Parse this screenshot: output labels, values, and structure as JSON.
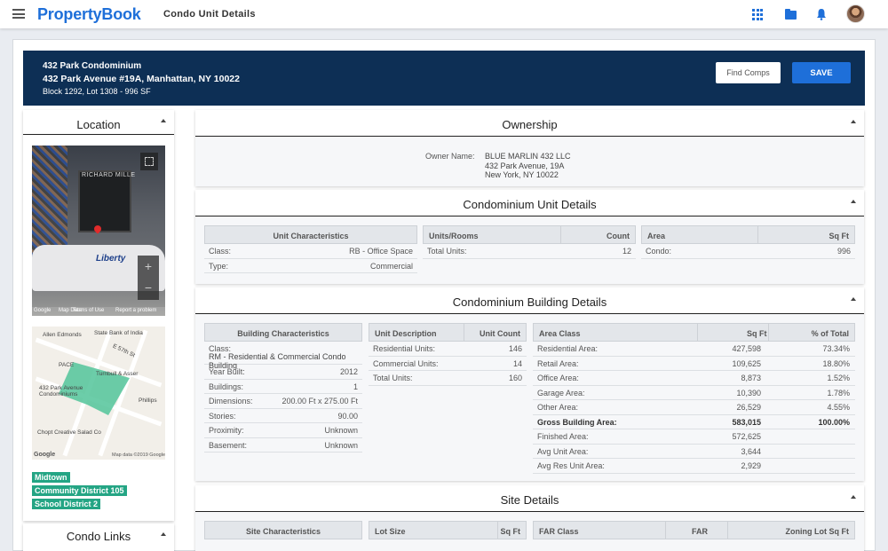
{
  "app": {
    "brand": "PropertyBook",
    "page_title": "Condo Unit Details"
  },
  "banner": {
    "line1": "432 Park Condominium",
    "line2": "432 Park Avenue #19A, Manhattan, NY 10022",
    "line3": "Block 1292, Lot 1308 - 996 SF",
    "find_comps_label": "Find Comps",
    "save_label": "SAVE"
  },
  "sidebar": {
    "location_title": "Location",
    "condo_links_title": "Condo Links",
    "streetview": {
      "store_sign": "RICHARD MILLE",
      "van_text": "Liberty",
      "terms": "Terms of Use",
      "report": "Report a problem",
      "map_data": "Map Data",
      "google": "Google"
    },
    "map": {
      "labels": [
        "Allen Edmonds",
        "State Bank of India",
        "E 57th St",
        "PACE",
        "Turnbull & Asser",
        "432 Park Avenue Condominiums",
        "Phillips",
        "Chopt Creative Salad Co"
      ],
      "footer": "Map data ©2019 Google",
      "google": "Google"
    },
    "tags": [
      "Midtown",
      "Community District 105",
      "School District 2"
    ]
  },
  "ownership": {
    "title": "Ownership",
    "owner_label": "Owner Name:",
    "owner_lines": [
      "BLUE MARLIN 432 LLC",
      "432 Park Avenue, 19A",
      "New York, NY 10022"
    ]
  },
  "unit_details": {
    "title": "Condominium Unit Details",
    "characteristics": {
      "header": "Unit Characteristics",
      "rows": [
        [
          "Class:",
          "RB - Office Space"
        ],
        [
          "Type:",
          "Commercial"
        ]
      ]
    },
    "units_rooms": {
      "header": "Units/Rooms",
      "count_header": "Count",
      "rows": [
        [
          "Total Units:",
          "12"
        ]
      ]
    },
    "area": {
      "header": "Area",
      "sqft_header": "Sq Ft",
      "rows": [
        [
          "Condo:",
          "996"
        ]
      ]
    }
  },
  "building_details": {
    "title": "Condominium Building Details",
    "characteristics": {
      "header": "Building Characteristics",
      "class_label": "Class:",
      "class_value": "RM - Residential & Commercial Condo Building",
      "rows": [
        [
          "Year Built:",
          "2012"
        ],
        [
          "Buildings:",
          "1"
        ],
        [
          "Dimensions:",
          "200.00 Ft x 275.00 Ft"
        ],
        [
          "Stories:",
          "90.00"
        ],
        [
          "Proximity:",
          "Unknown"
        ],
        [
          "Basement:",
          "Unknown"
        ]
      ]
    },
    "unit_description": {
      "header": "Unit Description",
      "count_header": "Unit Count",
      "rows": [
        [
          "Residential Units:",
          "146"
        ],
        [
          "Commercial Units:",
          "14"
        ],
        [
          "Total Units:",
          "160"
        ]
      ]
    },
    "area_class": {
      "header": "Area Class",
      "sqft_header": "Sq Ft",
      "pct_header": "% of Total",
      "rows": [
        [
          "Residential Area:",
          "427,598",
          "73.34%"
        ],
        [
          "Retail Area:",
          "109,625",
          "18.80%"
        ],
        [
          "Office Area:",
          "8,873",
          "1.52%"
        ],
        [
          "Garage Area:",
          "10,390",
          "1.78%"
        ],
        [
          "Other Area:",
          "26,529",
          "4.55%"
        ],
        [
          "Gross Building Area:",
          "583,015",
          "100.00%"
        ],
        [
          "Finished Area:",
          "572,625",
          ""
        ],
        [
          "Avg Unit Area:",
          "3,644",
          ""
        ],
        [
          "Avg Res Unit Area:",
          "2,929",
          ""
        ]
      ]
    }
  },
  "site_details": {
    "title": "Site Details",
    "characteristics_header": "Site Characteristics",
    "lot_size_header": "Lot Size",
    "lot_sqft_header": "Sq Ft",
    "far_class_header": "FAR Class",
    "far_header": "FAR",
    "zoning_header": "Zoning Lot Sq Ft"
  }
}
